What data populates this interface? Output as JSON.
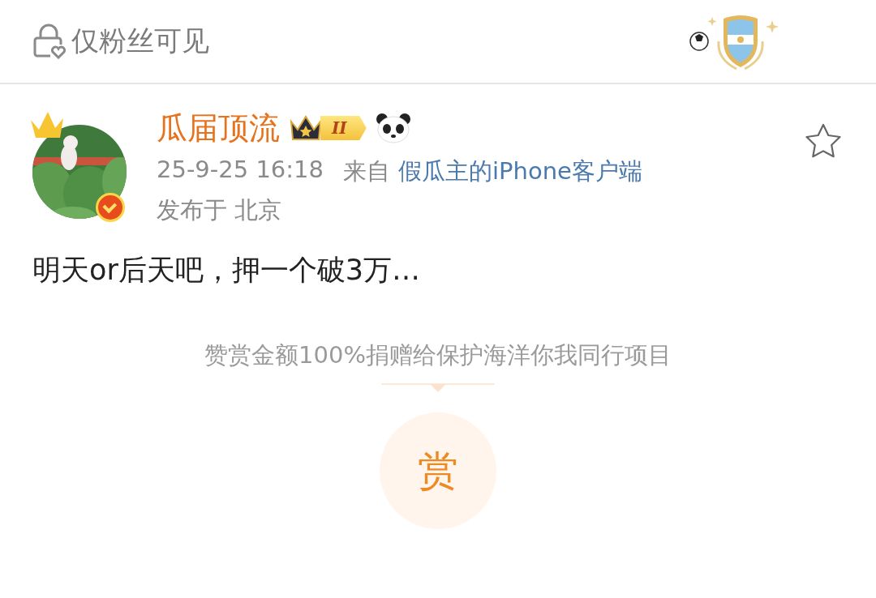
{
  "header": {
    "visibility_label": "仅粉丝可见"
  },
  "post": {
    "author": "瓜届顶流",
    "level_badge": "II",
    "timestamp": "25-9-25 16:18",
    "source_prefix": "来自",
    "source": "假瓜主的iPhone客户端",
    "location": "发布于 北京",
    "body": "明天or后天吧，押一个破3万…",
    "favorited": false
  },
  "reward": {
    "note": "赞赏金额100%捐赠给保护海洋你我同行项目",
    "button": "赏"
  }
}
